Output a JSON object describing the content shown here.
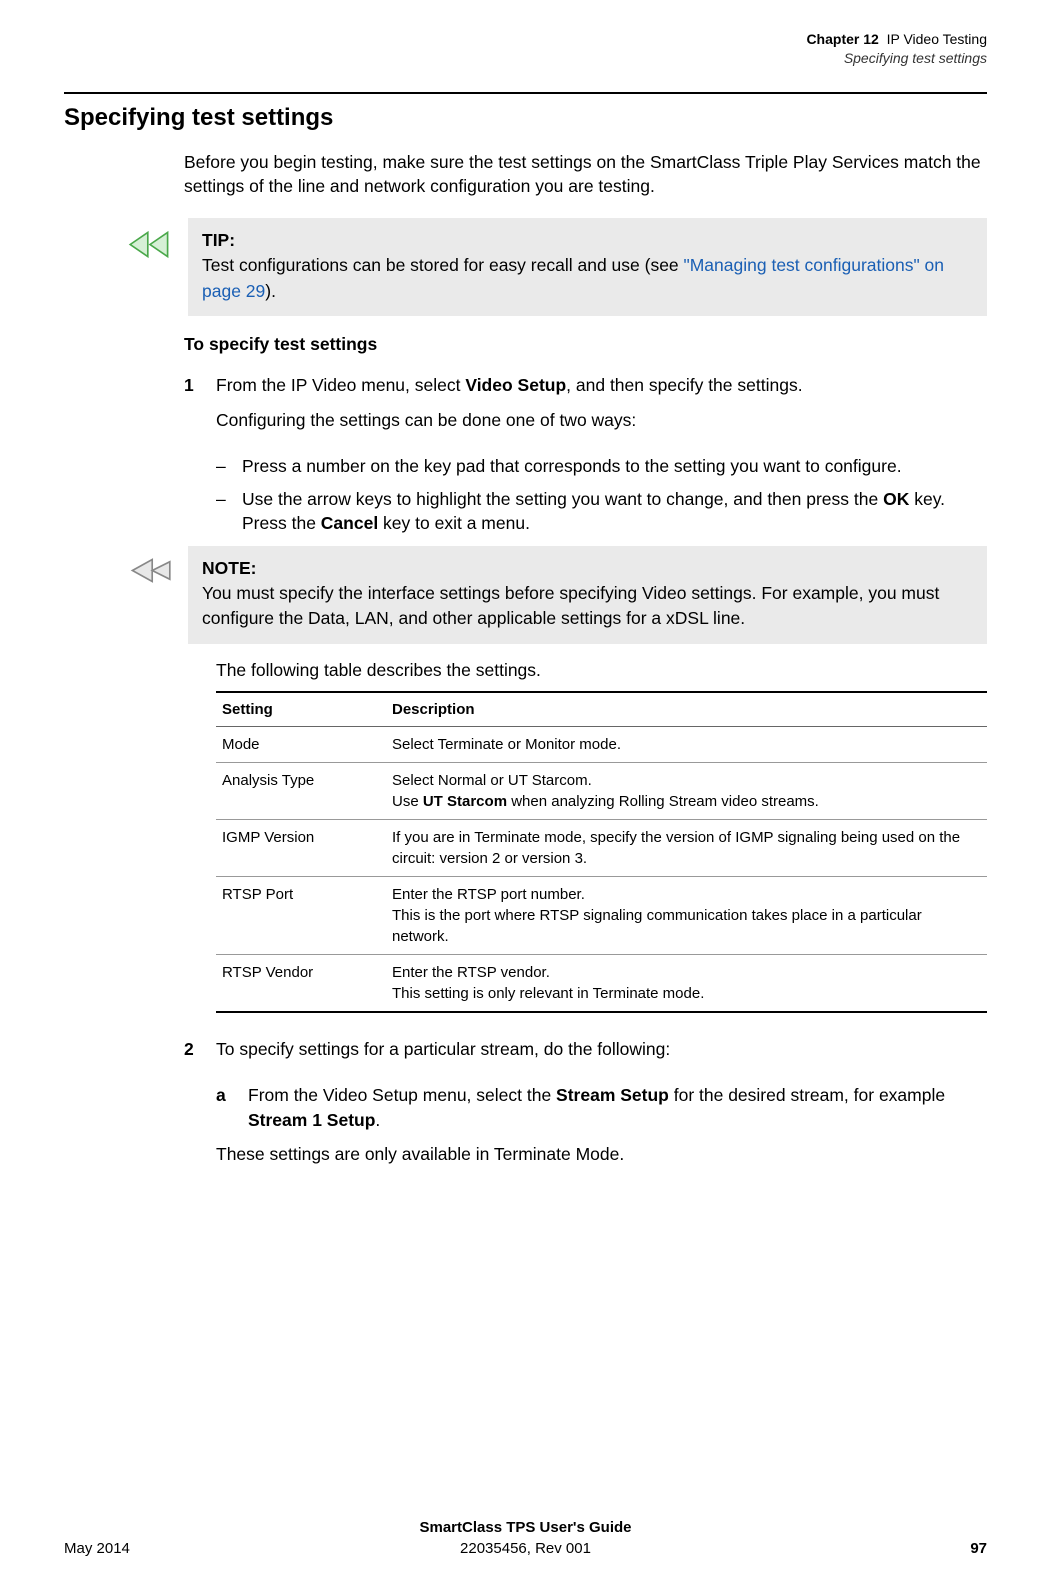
{
  "header": {
    "chapter_label": "Chapter 12",
    "chapter_title": "IP Video Testing",
    "section_title": "Specifying test settings"
  },
  "h1": "Specifying test settings",
  "intro": "Before you begin testing, make sure the test settings on the SmartClass Triple Play Services match the settings of the line and network configuration you are testing.",
  "tip": {
    "label": "TIP:",
    "text_before": "Test configurations can be stored for easy recall and use (see ",
    "link_text": "\"Managing test configurations\" on page 29",
    "text_after": ")."
  },
  "h2": "To specify test settings",
  "step1": {
    "num": "1",
    "line1_before": "From the IP Video menu, select ",
    "line1_bold": "Video Setup",
    "line1_after": ", and then specify the settings.",
    "line2": "Configuring the settings can be done one of two ways:"
  },
  "sublist1": {
    "a": "Press a number on the key pad that corresponds to the setting you want to configure.",
    "b_before": "Use the arrow keys to highlight the setting you want to change, and then press the ",
    "b_bold1": "OK",
    "b_mid": " key. Press the ",
    "b_bold2": "Cancel",
    "b_after": " key to exit a menu."
  },
  "note": {
    "label": "NOTE:",
    "text": "You must specify the interface settings before specifying Video settings. For example, you must configure the Data, LAN, and other applicable settings for a xDSL line."
  },
  "table_intro": "The following table describes the settings.",
  "table": {
    "head_setting": "Setting",
    "head_desc": "Description",
    "rows": [
      {
        "setting": "Mode",
        "desc_html": "Select Terminate or Monitor mode."
      },
      {
        "setting": "Analysis Type",
        "desc_html": "Select Normal or UT Starcom.<br>Use <b>UT Starcom</b> when analyzing Rolling Stream video streams."
      },
      {
        "setting": "IGMP Version",
        "desc_html": "If you are in Terminate mode, specify the version of IGMP signaling being used on the circuit: version 2 or version 3."
      },
      {
        "setting": "RTSP Port",
        "desc_html": "Enter the RTSP port number.<br>This is the port where RTSP signaling communication takes place in a particular network."
      },
      {
        "setting": "RTSP Vendor",
        "desc_html": "Enter the RTSP vendor.<br>This setting is only relevant in Terminate mode."
      }
    ]
  },
  "step2": {
    "num": "2",
    "line": "To specify settings for a particular stream, do the following:"
  },
  "substep_a": {
    "letter": "a",
    "before": "From the Video Setup menu, select the ",
    "bold1": "Stream Setup",
    "mid": " for the desired stream, for example ",
    "bold2": "Stream 1 Setup",
    "after": "."
  },
  "post_sub": "These settings are only available in Terminate Mode.",
  "footer": {
    "title": "SmartClass TPS User's Guide",
    "docnum": "22035456, Rev 001",
    "date": "May 2014",
    "page": "97"
  }
}
